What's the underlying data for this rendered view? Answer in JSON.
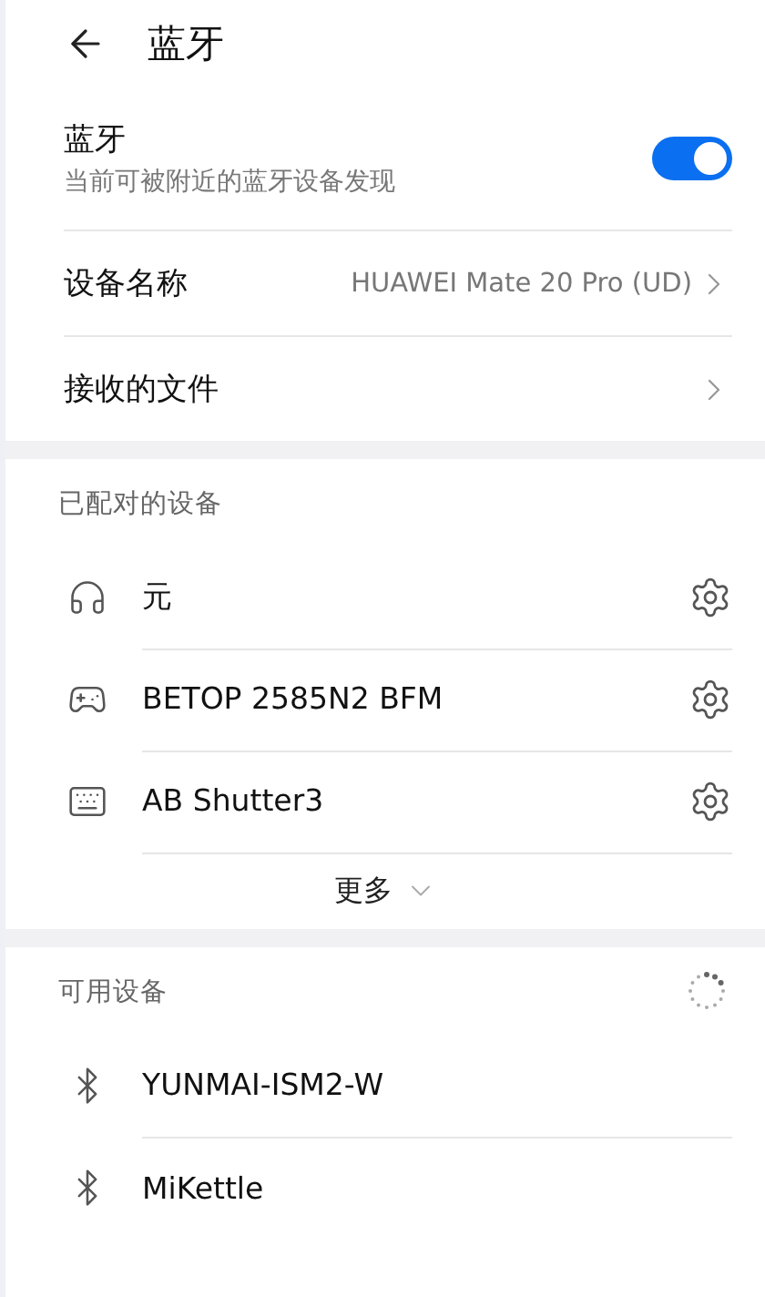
{
  "header": {
    "title": "蓝牙"
  },
  "bluetooth": {
    "label": "蓝牙",
    "description": "当前可被附近的蓝牙设备发现",
    "on": true
  },
  "settings": [
    {
      "label": "设备名称",
      "value": "HUAWEI Mate 20 Pro (UD)"
    },
    {
      "label": "接收的文件"
    }
  ],
  "paired_devices": {
    "heading": "已配对的设备",
    "more": "更多",
    "devices": [
      {
        "kind": "headphones",
        "name": "元"
      },
      {
        "kind": "gamepad",
        "name": "BETOP 2585N2 BFM"
      },
      {
        "kind": "keyboard",
        "name": "AB Shutter3"
      }
    ]
  },
  "available_devices": {
    "heading": "可用设备",
    "scanning": true,
    "devices": [
      {
        "kind": "bluetooth",
        "name": "YUNMAI-ISM2-W"
      },
      {
        "kind": "bluetooth",
        "name": "MiKettle"
      }
    ]
  }
}
